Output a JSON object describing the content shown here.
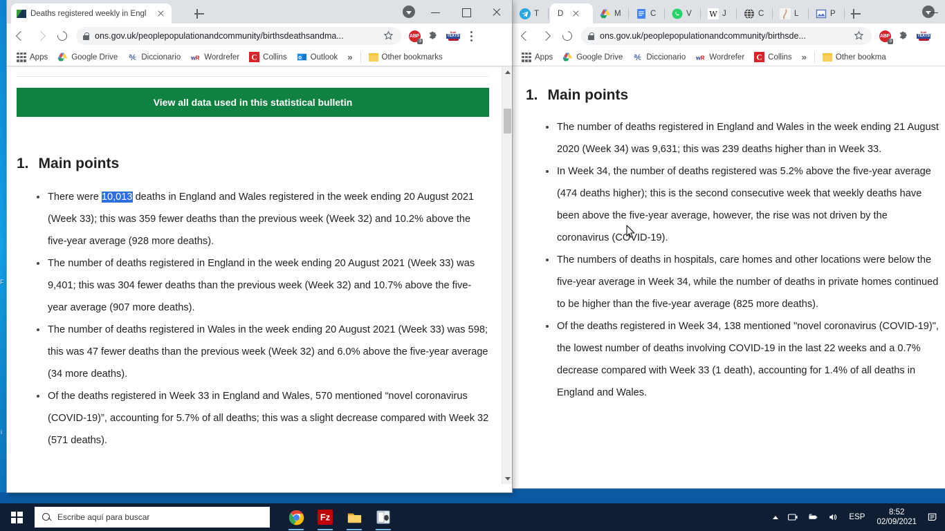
{
  "desktop": {
    "icon_label_1": "F",
    "icon_label_2": "i"
  },
  "window_left": {
    "tab": {
      "title": "Deaths registered weekly in Engl",
      "favicon": "ons-logo-icon",
      "close": "close-tab-icon"
    },
    "newtab_label": "+",
    "controls": {
      "minimize": "–",
      "maximize": "▢",
      "close": "✕"
    },
    "toolbar": {
      "back": "back-arrow-icon",
      "forward": "forward-arrow-icon",
      "reload": "reload-icon",
      "lock": "lock-icon",
      "url": "ons.gov.uk/peoplepopulationandcommunity/birthsdeathsandma...",
      "bookmark_star": "star-icon",
      "ext_abp": "ABP",
      "ext_abp_badge": "3",
      "ext_puzzle": "extensions-puzzle-icon",
      "ext_dual_top": "Dual",
      "ext_dual_mid": "TEXTS",
      "menu": "chrome-menu-icon"
    },
    "bookmarks": {
      "apps_label": "Apps",
      "items": [
        {
          "label": "Google Drive",
          "icon": "google-drive-icon"
        },
        {
          "label": "Diccionario",
          "icon": "dictionary-icon"
        },
        {
          "label": "Wordrefer",
          "icon": "wordreference-icon"
        },
        {
          "label": "Collins",
          "icon": "collins-icon"
        },
        {
          "label": "Outlook",
          "icon": "outlook-icon"
        }
      ],
      "overflow": "»",
      "other": "Other bookmarks"
    },
    "page": {
      "green_button": "View all data used in this statistical bulletin",
      "heading_number": "1.",
      "heading_text": "Main points",
      "bullets": [
        {
          "pre": "There were ",
          "highlight": "10,013",
          "post": " deaths in England and Wales registered in the week ending 20 August 2021 (Week 33); this was 359 fewer deaths than the previous week (Week 32) and 10.2% above the five-year average (928 more deaths)."
        },
        {
          "pre": "The number of deaths registered in England in the week ending 20 August 2021 (Week 33) was 9,401; this was 304 fewer deaths than the previous week (Week 32) and 10.7% above the five-year average (907 more deaths).",
          "highlight": "",
          "post": ""
        },
        {
          "pre": "The number of deaths registered in Wales in the week ending 20 August 2021 (Week 33) was 598; this was 47 fewer deaths than the previous week (Week 32) and 6.0% above the five-year average (34 more deaths).",
          "highlight": "",
          "post": ""
        },
        {
          "pre": "Of the deaths registered in Week 33 in England and Wales, 570 mentioned “novel coronavirus (COVID-19)”, accounting for 5.7% of all deaths; this was a slight decrease compared with Week 32 (571 deaths).",
          "highlight": "",
          "post": ""
        }
      ]
    }
  },
  "window_right": {
    "tabs": [
      {
        "icon": "telegram-icon",
        "label": "T",
        "active": false
      },
      {
        "icon": "document-icon",
        "label": "D",
        "active": true
      },
      {
        "icon": "google-drive-icon",
        "label": "M",
        "active": false
      },
      {
        "icon": "google-docs-icon",
        "label": "C",
        "active": false
      },
      {
        "icon": "whatsapp-icon",
        "label": "V",
        "active": false
      },
      {
        "icon": "wikipedia-icon",
        "label": "J",
        "active": false
      },
      {
        "icon": "globe-icon",
        "label": "C",
        "active": false
      },
      {
        "icon": "leg-icon",
        "label": "L",
        "active": false
      },
      {
        "icon": "image-icon",
        "label": "P",
        "active": false
      }
    ],
    "newtab_label": "+",
    "controls": {
      "minimize": "–",
      "maximize": "▢"
    },
    "toolbar": {
      "back": "back-arrow-icon",
      "forward": "forward-arrow-icon",
      "reload": "reload-icon",
      "lock": "lock-icon",
      "url": "ons.gov.uk/peoplepopulationandcommunity/birthsde...",
      "bookmark_star": "star-icon",
      "ext_abp": "ABP",
      "ext_abp_badge": "3",
      "ext_puzzle": "extensions-puzzle-icon",
      "ext_dual_top": "Dual",
      "ext_dual_mid": "TEXTS"
    },
    "bookmarks": {
      "apps_label": "Apps",
      "items": [
        {
          "label": "Google Drive",
          "icon": "google-drive-icon"
        },
        {
          "label": "Diccionario",
          "icon": "dictionary-icon"
        },
        {
          "label": "Wordrefer",
          "icon": "wordreference-icon"
        },
        {
          "label": "Collins",
          "icon": "collins-icon"
        }
      ],
      "overflow": "»",
      "other": "Other bookma"
    },
    "page": {
      "heading_number": "1.",
      "heading_text": "Main points",
      "bullets": [
        "The number of deaths registered in England and Wales in the week ending 21 August 2020 (Week 34) was 9,631; this was 239 deaths higher than in Week 33.",
        "In Week 34, the number of deaths registered was 5.2% above the five-year average (474 deaths higher); this is the second consecutive week that weekly deaths have been above the five-year average, however, the rise was not driven by the coronavirus (COVID-19).",
        "The numbers of deaths in hospitals, care homes and other locations were below the five-year average in Week 34, while the number of deaths in private homes continued to be higher than the five-year average (825 more deaths).",
        "Of the deaths registered in Week 34, 138 mentioned \"novel coronavirus (COVID-19)\", the lowest number of deaths involving COVID-19 in the last 22 weeks and a 0.7% decrease compared with Week 33 (1 death), accounting for 1.4% of all deaths in England and Wales."
      ]
    }
  },
  "taskbar": {
    "start": "windows-start-icon",
    "search_placeholder": "Escribe aquí para buscar",
    "apps": [
      {
        "name": "chrome-taskbar-icon",
        "running": true
      },
      {
        "name": "filezilla-taskbar-icon",
        "label": "Fz",
        "running": true
      },
      {
        "name": "file-explorer-taskbar-icon",
        "running": true
      },
      {
        "name": "scanner-taskbar-icon",
        "running": true
      }
    ],
    "tray": {
      "caret": "show-hidden-icons-caret",
      "screen": "screen-icon",
      "battery": "battery-icon",
      "volume": "volume-icon",
      "language": "ESP",
      "time": "8:52",
      "date": "02/09/2021",
      "notifications": "notifications-icon"
    }
  },
  "colors": {
    "ons_green": "#0f8140",
    "selection_blue": "#2b6fe0",
    "chrome_gray": "#dee1e6",
    "taskbar": "#101e33"
  }
}
